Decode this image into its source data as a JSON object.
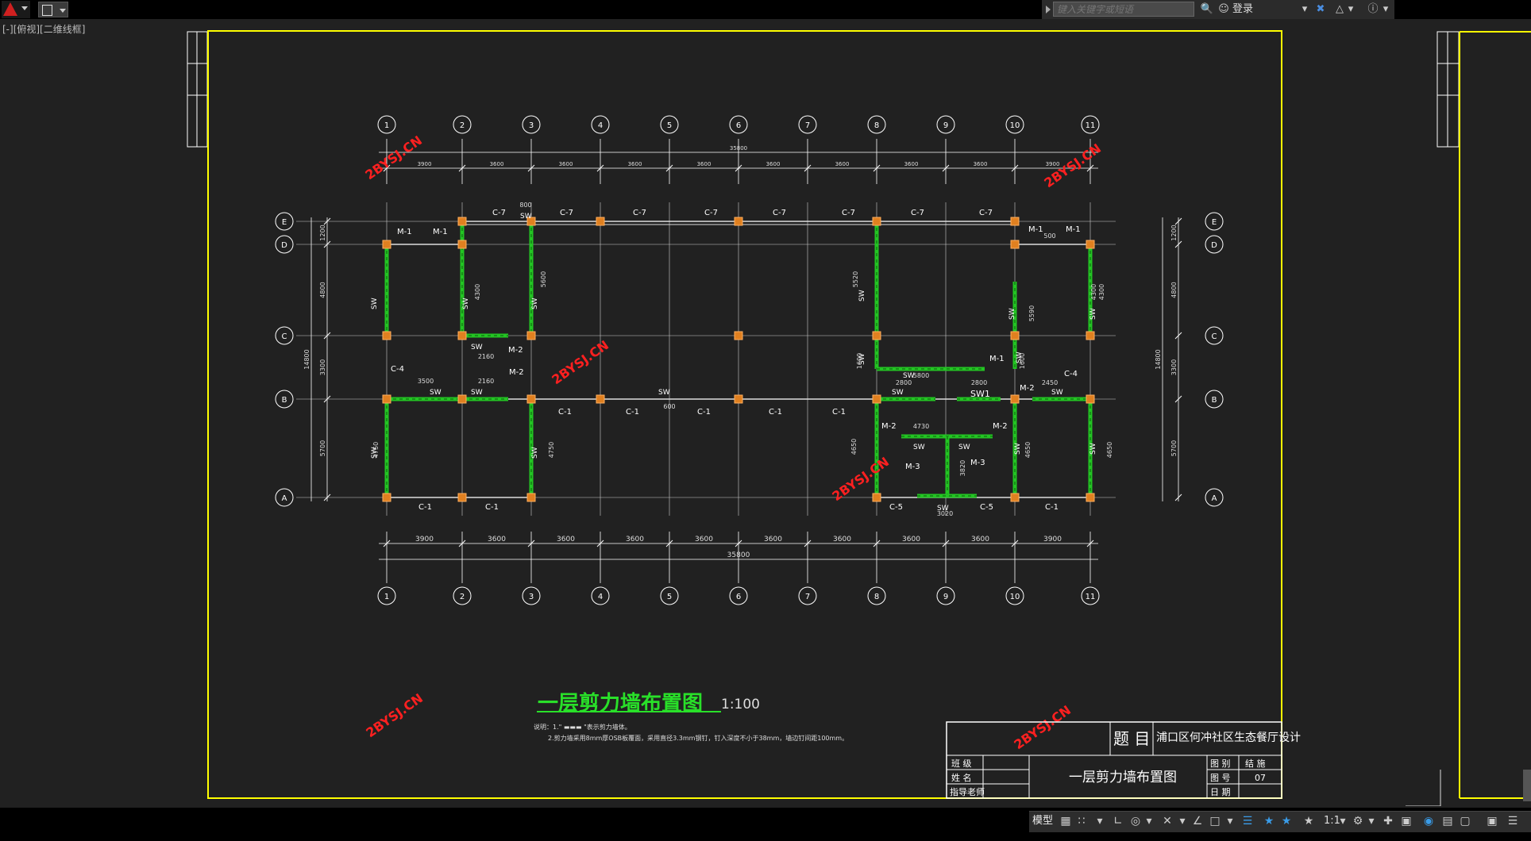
{
  "app": {
    "search_placeholder": "键入关键字或短语",
    "login_label": "登录",
    "viewport_label": "[-][俯视][二维线框]"
  },
  "status_bar": {
    "model_tab": "模型",
    "scale": "1:1"
  },
  "drawing": {
    "title": "一层剪力墙布置图",
    "scale_text": "1:100",
    "notes": [
      "说明：1.\" ▬▬▬ \"表示剪力墙体。",
      "2.剪力墙采用8mm厚OSB板覆面，采用直径3.3mm钢钉，钉入深度不小于38mm，墙边钉间距100mm。"
    ],
    "watermark": "2BYSJ.CN",
    "axes_numbers": [
      "1",
      "2",
      "3",
      "4",
      "5",
      "6",
      "7",
      "8",
      "9",
      "10",
      "11"
    ],
    "axes_letters": [
      "A",
      "B",
      "C",
      "D",
      "E"
    ],
    "top_total_dim": "35800",
    "bottom_total_dim": "35800",
    "top_dims": [
      "3900",
      "3600",
      "3600",
      "3600",
      "3600",
      "3600",
      "3600",
      "3600",
      "3600",
      "3900"
    ],
    "bottom_dims": [
      "3900",
      "3600",
      "3600",
      "3600",
      "3600",
      "3600",
      "3600",
      "3600",
      "3600",
      "3900"
    ],
    "left_outer_dims": [
      "1200",
      "4800",
      "3300",
      "5700"
    ],
    "left_total_dim": "14800",
    "right_outer_dims": [
      "1200",
      "4800",
      "3300",
      "5700"
    ],
    "right_total_dim": "14800",
    "labels": {
      "c7": "C-7",
      "c1": "C-1",
      "c4": "C-4",
      "c5": "C-5",
      "m1": "M-1",
      "m2": "M-2",
      "m3": "M-3",
      "sw": "SW",
      "sw1": "SW1"
    },
    "inner_dims": [
      "800",
      "4300",
      "5600",
      "5520",
      "4300",
      "5590",
      "4300",
      "2160",
      "3500",
      "2160",
      "1600",
      "5800",
      "1600",
      "2800",
      "2800",
      "2450",
      "4750",
      "4750",
      "4650",
      "4730",
      "3820",
      "4650",
      "4650",
      "3020",
      "500",
      "600"
    ]
  },
  "title_block": {
    "label_title": "题  目",
    "project_name": "浦口区何冲社区生态餐厅设计",
    "class_label": "班  级",
    "name_label": "姓  名",
    "advisor_label": "指导老师",
    "drawing_name": "一层剪力墙布置图",
    "category_label": "图  别",
    "category_value": "结  施",
    "number_label": "图  号",
    "number_value": "07",
    "date_label": "日  期"
  },
  "colors": {
    "frame": "#ffff00",
    "wall": "#23c423",
    "axis": "#ffffff",
    "title_green": "#29e029",
    "column": "#e08020",
    "watermark": "#ff2020"
  }
}
